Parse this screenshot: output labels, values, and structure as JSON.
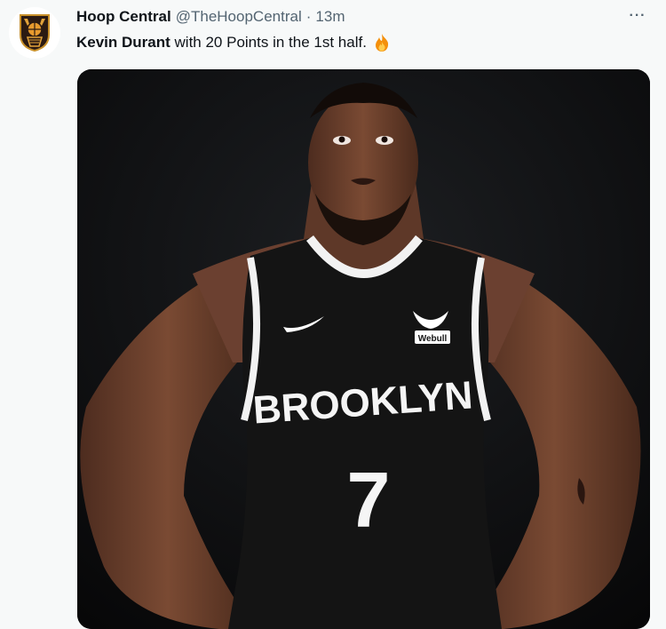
{
  "tweet": {
    "display_name": "Hoop Central",
    "handle": "@TheHoopCentral",
    "separator": "·",
    "time": "13m",
    "text_bold": "Kevin Durant",
    "text_rest": " with 20 Points in the 1st half.",
    "emoji_icon": "fire-icon",
    "more_icon": "more-options-icon",
    "more_label": "···"
  },
  "media": {
    "jersey_team": "BROOKLYN",
    "jersey_number": "7",
    "patch_text": "Webull"
  },
  "colors": {
    "background": "#f7f9f9",
    "text_primary": "#0f1419",
    "text_secondary": "#536471",
    "jersey": "#141414",
    "skin": "#6e4330"
  }
}
